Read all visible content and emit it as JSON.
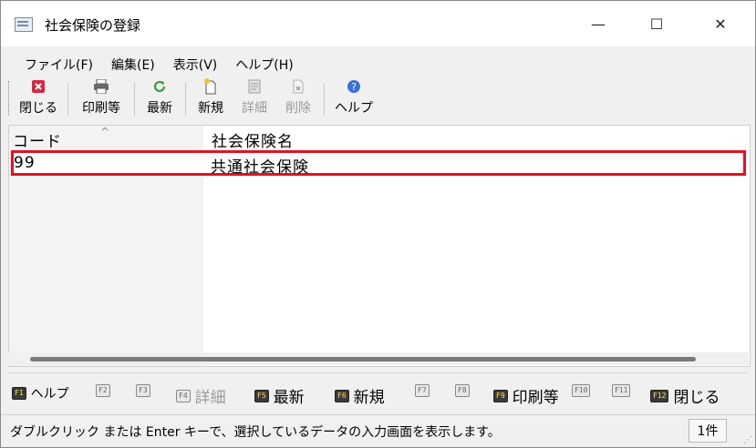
{
  "window": {
    "title": "社会保険の登録",
    "minimize_glyph": "—",
    "maximize_glyph": "☐",
    "close_glyph": "✕"
  },
  "menu": [
    "ファイル(F)",
    "編集(E)",
    "表示(V)",
    "ヘルプ(H)"
  ],
  "toolbar": {
    "close_label": "閉じる",
    "print_label": "印刷等",
    "refresh_label": "最新",
    "new_label": "新規",
    "detail_label": "詳細",
    "delete_label": "削除",
    "help_label": "ヘルプ"
  },
  "list": {
    "columns": [
      "コード",
      "社会保険名"
    ],
    "sort_indicator": "^",
    "rows": [
      {
        "code": "99",
        "name": "共通社会保険"
      }
    ]
  },
  "fkeys": [
    {
      "key": "F1",
      "label": "ヘルプ"
    },
    {
      "key": "F2",
      "label": ""
    },
    {
      "key": "F3",
      "label": ""
    },
    {
      "key": "F4",
      "label": "詳細"
    },
    {
      "key": "F5",
      "label": "最新"
    },
    {
      "key": "F6",
      "label": "新規"
    },
    {
      "key": "F7",
      "label": ""
    },
    {
      "key": "F8",
      "label": ""
    },
    {
      "key": "F9",
      "label": "印刷等"
    },
    {
      "key": "F10",
      "label": ""
    },
    {
      "key": "F11",
      "label": ""
    },
    {
      "key": "F12",
      "label": "閉じる"
    }
  ],
  "status": {
    "message": "ダブルクリック または Enter キーで、選択しているデータの入力画面を表示します。",
    "count": "1件"
  },
  "colors": {
    "selection_border": "#e0141f",
    "fkey_badge_active": "#3a3a3a",
    "fkey_badge_text": "#ffe24a"
  }
}
